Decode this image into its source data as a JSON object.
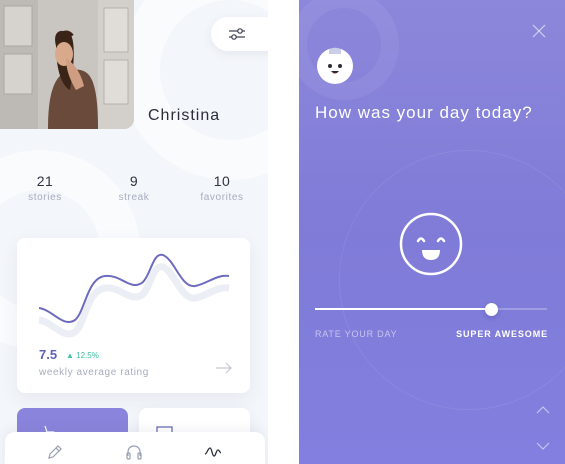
{
  "profile": {
    "name": "Christina",
    "photo_icon": "profile-photo",
    "filter_icon": "sliders-icon"
  },
  "stats": [
    {
      "value": "21",
      "label": "stories"
    },
    {
      "value": "9",
      "label": "streak"
    },
    {
      "value": "10",
      "label": "favorites"
    }
  ],
  "rating_card": {
    "value": "7.5",
    "delta": "12.5%",
    "delta_direction": "up",
    "label": "weekly average rating",
    "arrow_icon": "arrow-right-icon"
  },
  "tabbar": {
    "items": [
      "pencil-icon",
      "headphones-icon",
      "activity-icon"
    ],
    "active": "activity-icon"
  },
  "mood": {
    "question": "How was your day today?",
    "rate_label": "RATE YOUR DAY",
    "rate_value": "SUPER AWESOME",
    "slider_value": 0.76,
    "close_icon": "close-icon",
    "avatar_icon": "mascot-avatar",
    "face_icon": "smiley-face-icon",
    "up_icon": "chevron-up-icon",
    "down_icon": "chevron-down-icon"
  },
  "colors": {
    "accent": "#5c63b7",
    "positive": "#3cc3a0",
    "mood_bg_top": "#8d87db",
    "mood_bg_bottom": "#837fe0"
  }
}
